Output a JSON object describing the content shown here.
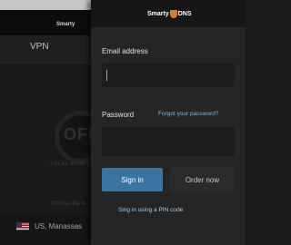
{
  "background_app": {
    "logo_text": "Smarty",
    "tab_vpn": "VPN",
    "power_text": "OFF",
    "status_text": "You are discon",
    "choose_text": "Choose the lo",
    "location_label": "US, Manassas"
  },
  "drawer": {
    "logo_text": "Smarty",
    "logo_suffix": "DNS",
    "email_label": "Email address",
    "email_value": "",
    "password_label": "Password",
    "password_value": "",
    "forgot_link": "Forgot your password?",
    "sign_in_button": "Sign in",
    "order_now_button": "Order now",
    "pin_link": "Sing in using a PIN code"
  },
  "colors": {
    "accent_blue": "#3b74a0",
    "link_blue": "#7fb6e8",
    "brand_orange": "#e8772a",
    "cursor_orange": "#e6a11a"
  },
  "icons": {
    "brand": "shield-logo-icon",
    "flag": "us-flag-icon"
  }
}
